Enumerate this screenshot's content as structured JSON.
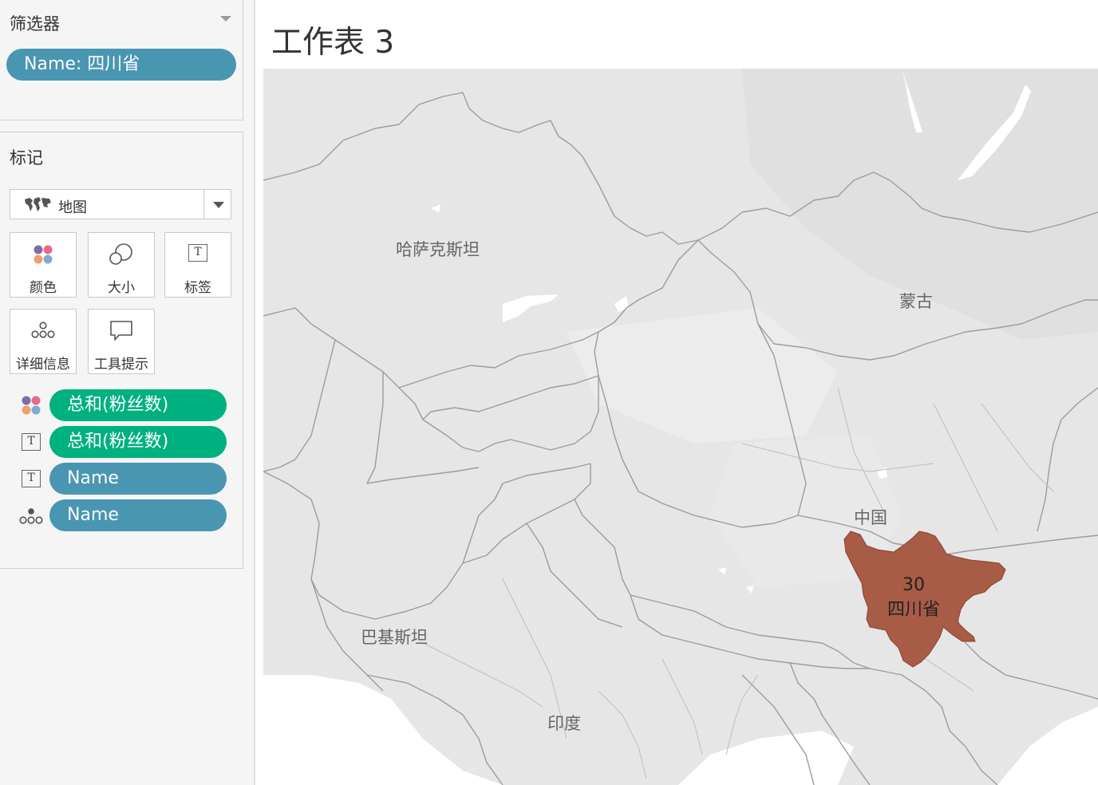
{
  "filters": {
    "title": "筛选器",
    "pill": "Name: 四川省"
  },
  "marks": {
    "title": "标记",
    "mark_type": {
      "icon": "map-icon",
      "label": "地图"
    },
    "buttons": [
      {
        "id": "color",
        "label": "颜色",
        "icon": "color-dots-icon"
      },
      {
        "id": "size",
        "label": "大小",
        "icon": "size-circles-icon"
      },
      {
        "id": "label",
        "label": "标签",
        "icon": "text-t-icon"
      },
      {
        "id": "detail",
        "label": "详细信息",
        "icon": "detail-dots-icon"
      },
      {
        "id": "tooltip",
        "label": "工具提示",
        "icon": "speech-bubble-icon"
      }
    ],
    "fields": [
      {
        "icon": "color-dots-icon",
        "label": "总和(粉丝数)",
        "color": "#00b180"
      },
      {
        "icon": "text-t-icon",
        "label": "总和(粉丝数)",
        "color": "#00b180"
      },
      {
        "icon": "text-t-icon",
        "label": "Name",
        "color": "#4996b2"
      },
      {
        "icon": "detail-dots-icon",
        "label": "Name",
        "color": "#4996b2"
      }
    ]
  },
  "sheet": {
    "title": "工作表 3"
  },
  "map": {
    "place_labels": [
      "哈萨克斯坦",
      "蒙古",
      "中国",
      "巴基斯坦",
      "印度"
    ],
    "highlight": {
      "region": "四川省",
      "value": "30",
      "color": "#a85b45"
    }
  },
  "colors": {
    "pill_blue": "#4996b2",
    "pill_green": "#00b180",
    "map_bg": "#e8e8e8",
    "border": "#9c9c9c"
  }
}
